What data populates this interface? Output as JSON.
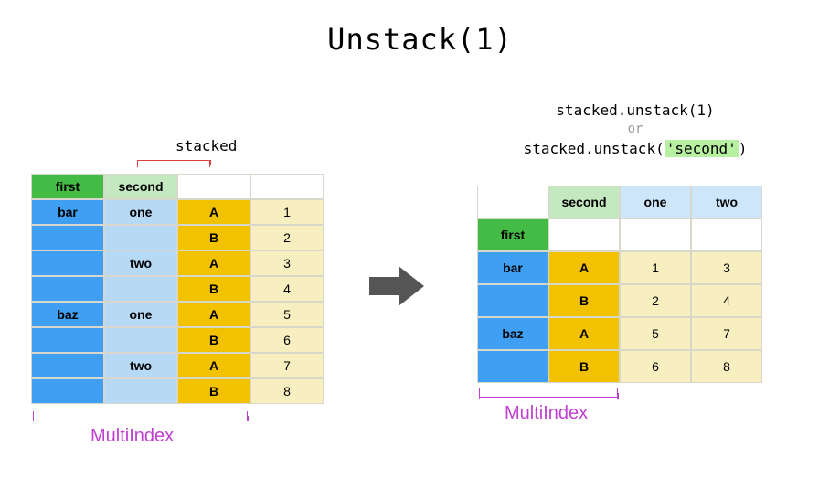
{
  "title": "Unstack(1)",
  "left": {
    "label": "stacked",
    "headers": [
      "first",
      "second",
      "",
      ""
    ],
    "firstCol": [
      "bar",
      "",
      "",
      "",
      "baz",
      "",
      "",
      ""
    ],
    "secondCol": [
      "one",
      "",
      "two",
      "",
      "one",
      "",
      "two",
      ""
    ],
    "letterCol": [
      "A",
      "B",
      "A",
      "B",
      "A",
      "B",
      "A",
      "B"
    ],
    "valueCol": [
      "1",
      "2",
      "3",
      "4",
      "5",
      "6",
      "7",
      "8"
    ],
    "multiindex": "MultiIndex"
  },
  "code": {
    "line1": "stacked.unstack(1)",
    "or": "or",
    "line2a": "stacked.unstack(",
    "line2b": "'second'",
    "line2c": ")"
  },
  "right": {
    "hdr1": [
      "",
      "second",
      "one",
      "two"
    ],
    "hdr2": [
      "first",
      "",
      "",
      ""
    ],
    "firstCol": [
      "bar",
      "",
      "baz",
      ""
    ],
    "letterCol": [
      "A",
      "B",
      "A",
      "B"
    ],
    "oneCol": [
      "1",
      "2",
      "5",
      "6"
    ],
    "twoCol": [
      "3",
      "4",
      "7",
      "8"
    ],
    "multiindex": "MultiIndex"
  },
  "chart_data": {
    "type": "table",
    "description": "Illustration of pandas DataFrame unstack(1) / unstack('second') from a stacked MultiIndex (levels first, second, inner A/B)",
    "stacked": {
      "index_levels": [
        "first",
        "second"
      ],
      "rows": [
        {
          "first": "bar",
          "second": "one",
          "key": "A",
          "value": 1
        },
        {
          "first": "bar",
          "second": "one",
          "key": "B",
          "value": 2
        },
        {
          "first": "bar",
          "second": "two",
          "key": "A",
          "value": 3
        },
        {
          "first": "bar",
          "second": "two",
          "key": "B",
          "value": 4
        },
        {
          "first": "baz",
          "second": "one",
          "key": "A",
          "value": 5
        },
        {
          "first": "baz",
          "second": "one",
          "key": "B",
          "value": 6
        },
        {
          "first": "baz",
          "second": "two",
          "key": "A",
          "value": 7
        },
        {
          "first": "baz",
          "second": "two",
          "key": "B",
          "value": 8
        }
      ]
    },
    "unstacked": {
      "operation": "stacked.unstack(1)",
      "alt_operation": "stacked.unstack('second')",
      "index_level": "first",
      "column_level": "second",
      "columns": [
        "one",
        "two"
      ],
      "rows": [
        {
          "first": "bar",
          "key": "A",
          "one": 1,
          "two": 3
        },
        {
          "first": "bar",
          "key": "B",
          "one": 2,
          "two": 4
        },
        {
          "first": "baz",
          "key": "A",
          "one": 5,
          "two": 7
        },
        {
          "first": "baz",
          "key": "B",
          "one": 6,
          "two": 8
        }
      ]
    }
  }
}
